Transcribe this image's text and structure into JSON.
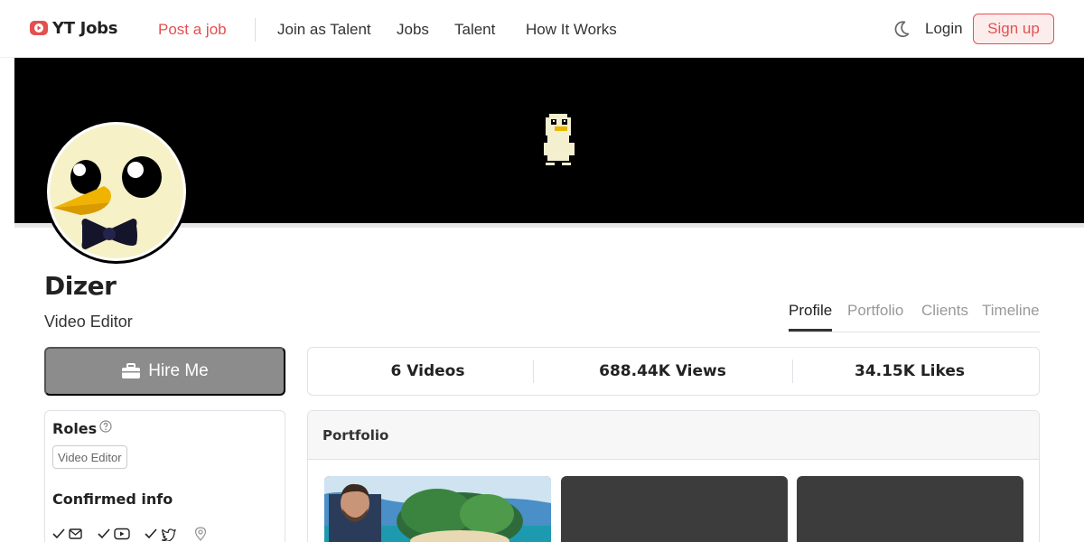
{
  "brand": {
    "name": "YT Jobs",
    "accent": "#e2504f"
  },
  "nav": {
    "links": [
      {
        "label": "Post a job",
        "icon": null
      },
      {
        "label": "Join as Talent"
      },
      {
        "label": "Jobs"
      },
      {
        "label": "Talent"
      },
      {
        "label": "How It Works"
      }
    ],
    "theme_icon": "moon-icon",
    "login": "Login",
    "signup": "Sign up"
  },
  "profile": {
    "name": "Dizer",
    "title": "Video Editor",
    "hire_label": "Hire Me",
    "hire_icon": "briefcase-icon"
  },
  "tabs": [
    {
      "label": "Profile",
      "active": true
    },
    {
      "label": "Portfolio",
      "active": false
    },
    {
      "label": "Clients",
      "active": false
    },
    {
      "label": "Timeline",
      "active": false
    }
  ],
  "stats": [
    {
      "label": "6 Videos"
    },
    {
      "label": "688.44K Views"
    },
    {
      "label": "34.15K Likes"
    }
  ],
  "sidebar": {
    "roles_heading": "Roles",
    "roles": [
      "Video Editor"
    ],
    "confirmed_heading": "Confirmed info",
    "confirmed_icons": [
      "email-icon",
      "youtube-icon",
      "twitter-icon",
      "location-icon"
    ]
  },
  "portfolio": {
    "heading": "Portfolio",
    "items": 3
  }
}
